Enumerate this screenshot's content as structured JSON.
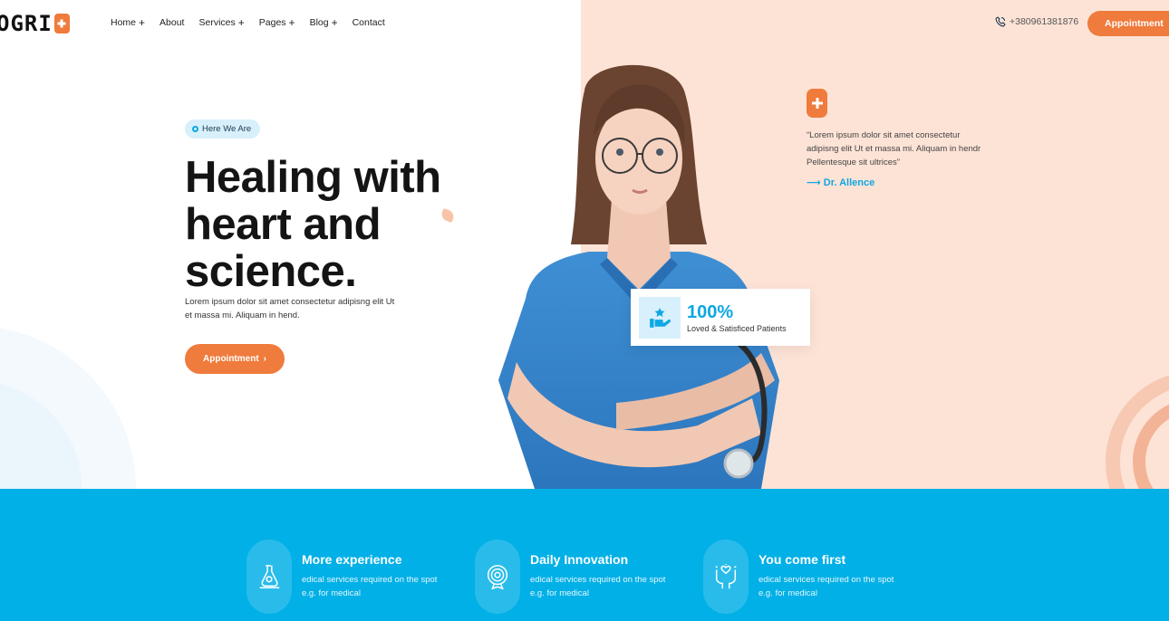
{
  "header": {
    "logo_text": "OGRI",
    "nav": [
      {
        "label": "Home",
        "has_plus": true
      },
      {
        "label": "About",
        "has_plus": false
      },
      {
        "label": "Services",
        "has_plus": true
      },
      {
        "label": "Pages",
        "has_plus": true
      },
      {
        "label": "Blog",
        "has_plus": true
      },
      {
        "label": "Contact",
        "has_plus": false
      }
    ],
    "nav_plus": "+",
    "phone": "+380961381876",
    "appointment_label": "Appointment"
  },
  "hero": {
    "badge": "Here We Are",
    "title_lines": [
      "Healing with",
      "heart and",
      "science."
    ],
    "description": "Lorem ipsum dolor sit amet consectetur adipisng elit Ut et massa mi. Aliquam in hend.",
    "appointment_label": "Appointment",
    "appointment_arrow": "›"
  },
  "stat_card": {
    "value": "100%",
    "label": "Loved & Satisficed Patients"
  },
  "quote": {
    "text": "“Lorem ipsum dolor sit amet consectetur adipisng elit Ut et massa mi. Aliquam in hendr Pellentesque sit ultrices”",
    "author": "Dr. Allence",
    "arrow": "⟶"
  },
  "features": [
    {
      "title": "More experience",
      "line1": "edical services required on the spot",
      "line2": "e.g. for medical",
      "icon": "microscope-icon"
    },
    {
      "title": "Daily Innovation",
      "line1": "edical services required on the spot",
      "line2": "e.g. for medical",
      "icon": "target-icon"
    },
    {
      "title": "You come first",
      "line1": "edical services required on the spot",
      "line2": "e.g. for medical",
      "icon": "heart-hands-icon"
    }
  ],
  "colors": {
    "accent": "#ef7b3c",
    "brand_blue": "#0ea7e3",
    "band_blue": "#01b0e6",
    "peach_bg": "#fde3d6"
  }
}
